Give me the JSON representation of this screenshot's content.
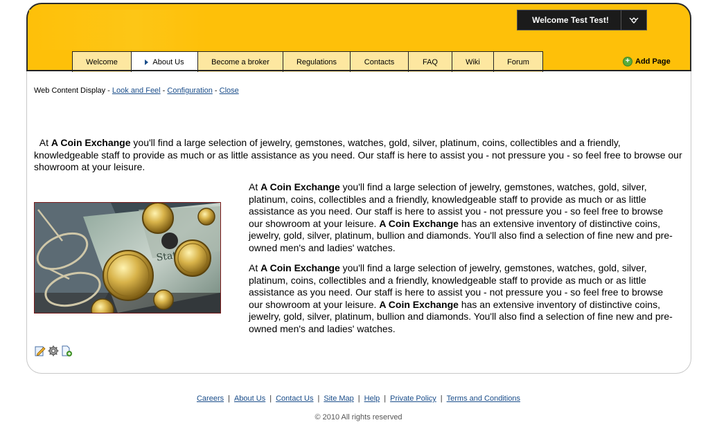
{
  "header": {
    "welcome_text": "Welcome Test Test!",
    "accent_color": "#fec009"
  },
  "nav": {
    "tabs": [
      {
        "label": "Welcome",
        "active": false
      },
      {
        "label": "About Us",
        "active": true
      },
      {
        "label": "Become a broker",
        "active": false
      },
      {
        "label": "Regulations",
        "active": false
      },
      {
        "label": "Contacts",
        "active": false
      },
      {
        "label": "FAQ",
        "active": false
      },
      {
        "label": "Wiki",
        "active": false
      },
      {
        "label": "Forum",
        "active": false
      }
    ],
    "add_page_label": "Add Page"
  },
  "portlet": {
    "title": "Web Content Display",
    "sep": " - ",
    "links": [
      "Look and Feel",
      "Configuration",
      "Close"
    ]
  },
  "content": {
    "p1": {
      "pre": "  At ",
      "bold1": "A Coin Exchange",
      "rest": " you'll find a large selection of jewelry, gemstones, watches, gold, silver, platinum, coins, collectibles and a friendly, knowledgeable staff to provide as much or as little assistance as you need. Our staff is here to assist you - not pressure you - so feel free to browse our  showroom at your leisure."
    },
    "p2": {
      "pre": "At ",
      "bold1": "A Coin Exchange",
      "mid": " you'll find a large selection of jewelry, gemstones, watches, gold, silver, platinum, coins, collectibles and a friendly, knowledgeable staff to provide as much or as little assistance as you need. Our staff is here to assist you - not pressure you - so feel free to browse our  showroom at your leisure. ",
      "bold2": "A Coin Exchange",
      "rest": " has an extensive inventory of distinctive coins, jewelry, gold, silver, platinum, bullion and diamonds. You'll also find a selection of fine new and pre-owned men's and ladies' watches."
    },
    "p3": {
      "pre": "At ",
      "bold1": "A Coin Exchange",
      "mid": " you'll find a large selection of jewelry, gemstones, watches, gold, silver, platinum, coins, collectibles and a friendly, knowledgeable staff to provide as much or as little assistance as you need. Our staff is here to assist you - not pressure you - so feel free to browse our  showroom at your leisure. ",
      "bold2": "A Coin Exchange",
      "rest": " has an extensive inventory of distinctive coins, jewelry, gold, silver, platinum, bullion and diamonds. You'll also find a selection of fine new and pre-owned men's and ladies' watches."
    },
    "icons": [
      "edit-icon",
      "gear-icon",
      "add-content-icon"
    ]
  },
  "footer": {
    "links": [
      "Careers",
      "About Us",
      "Contact Us",
      "Site Map",
      "Help",
      "Private Policy",
      "Terms and Conditions"
    ],
    "separator": "|",
    "copyright": "© 2010 All rights reserved"
  }
}
